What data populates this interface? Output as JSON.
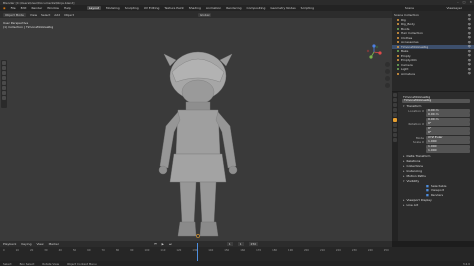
{
  "window": {
    "title": "Blender [C:\\Users\\User\\Documents\\Ninja.blend]"
  },
  "menus": [
    "File",
    "Edit",
    "Render",
    "Window",
    "Help"
  ],
  "workspaces": [
    "Layout",
    "Modeling",
    "Sculpting",
    "UV Editing",
    "Texture Paint",
    "Shading",
    "Animation",
    "Rendering",
    "Compositing",
    "Geometry Nodes",
    "Scripting"
  ],
  "active_workspace": "Layout",
  "scene": {
    "label": "Scene",
    "layer": "ViewLayer"
  },
  "viewport_header": {
    "mode": "Object Mode",
    "items": [
      "View",
      "Select",
      "Add",
      "Object"
    ],
    "transform": "Global"
  },
  "viewport": {
    "view_name": "User Perspective",
    "collection": "(1) Collection | TimonaMobilesRig"
  },
  "outliner": {
    "rows": [
      {
        "label": "Scene Collection",
        "sel": false,
        "color": "none"
      },
      {
        "label": "Rig",
        "sel": false,
        "color": "orange"
      },
      {
        "label": "Rig_Body",
        "sel": false,
        "color": "orange"
      },
      {
        "label": "Boots",
        "sel": false,
        "color": "green"
      },
      {
        "label": "Hair Collection",
        "sel": false,
        "color": "orange"
      },
      {
        "label": "Clothes",
        "sel": false,
        "color": "orange"
      },
      {
        "label": "Accessories",
        "sel": false,
        "color": "orange"
      },
      {
        "label": "TimonaMobilesRig",
        "sel": true,
        "color": "orange"
      },
      {
        "label": "Bake",
        "sel": false,
        "color": "green"
      },
      {
        "label": "Empty",
        "sel": false,
        "color": "orange"
      },
      {
        "label": "Empty.001",
        "sel": false,
        "color": "orange"
      },
      {
        "label": "Camera",
        "sel": false,
        "color": "green"
      },
      {
        "label": "Light",
        "sel": false,
        "color": "green"
      },
      {
        "label": "Armature",
        "sel": false,
        "color": "orange"
      }
    ]
  },
  "properties": {
    "object_name": "TimonaMobilesRig",
    "field_name": "TimonaMobilesRig",
    "transform_label": "Transform",
    "location_label": "Location X",
    "location": [
      "0.00 m",
      "0.00 m",
      "0.00 m"
    ],
    "rotation_label": "Rotation X",
    "rotation": [
      "0°",
      "0°",
      "0°"
    ],
    "mode_label": "Mode",
    "mode_value": "XYZ Euler",
    "scale_label": "Scale X",
    "scale": [
      "1.000",
      "1.000",
      "1.000"
    ],
    "sections": [
      "Delta Transform",
      "Relations",
      "Collections",
      "Instancing",
      "Motion Paths",
      "Visibility"
    ],
    "vis_items": [
      "Selectable",
      "Viewport",
      "Renders"
    ],
    "viewport_display": "Viewport Display",
    "line_art": "Line Art"
  },
  "timeline": {
    "menus": [
      "Playback",
      "Keying",
      "View",
      "Marker"
    ],
    "ticks": [
      "0",
      "10",
      "20",
      "30",
      "40",
      "50",
      "60",
      "70",
      "80",
      "90",
      "100",
      "110",
      "120",
      "130",
      "140",
      "150",
      "160",
      "170",
      "180",
      "190",
      "200",
      "210",
      "220",
      "230",
      "240",
      "250"
    ],
    "current_frame": "1",
    "start": "1",
    "end": "250"
  },
  "status": [
    "Select",
    "Box Select",
    "Rotate View",
    "Object Context Menu"
  ],
  "version": "3.2.0",
  "colors": {
    "accent": "#4d8fe0",
    "viewport_bg": "#3a3a3a",
    "model": "#9a9a9a"
  }
}
